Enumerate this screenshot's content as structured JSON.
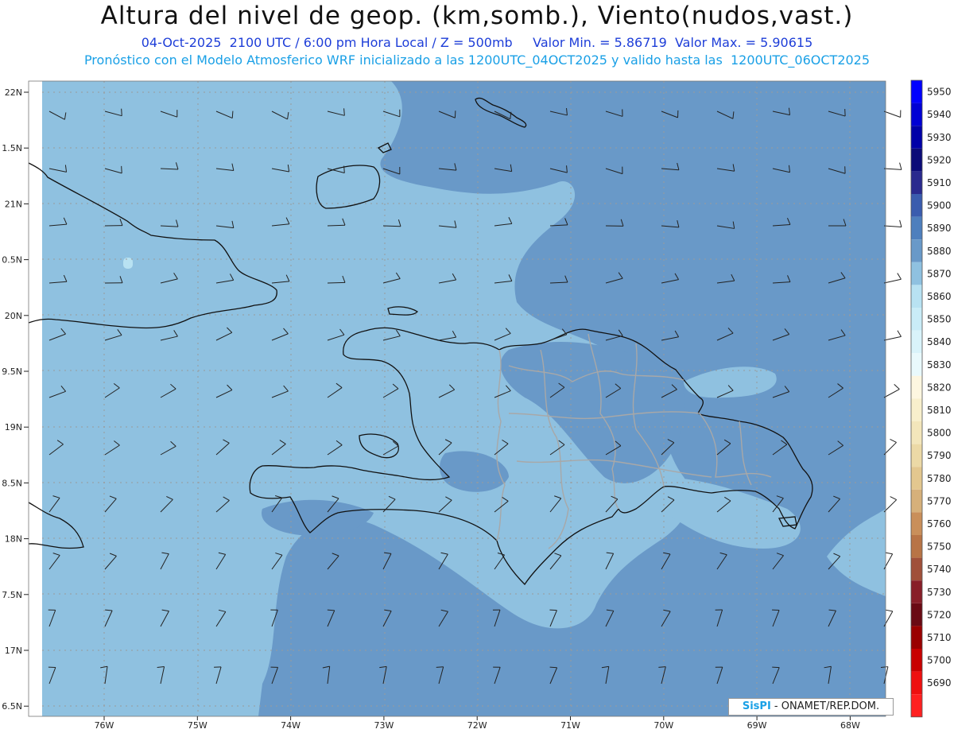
{
  "header": {
    "title": "Altura del nivel de geop. (km,somb.), Viento(nudos,vast.)",
    "line1": "04-Oct-2025  2100 UTC / 6:00 pm Hora Local / Z = 500mb     Valor Min. = 5.86719  Valor Max. = 5.90615",
    "line2": "Pronóstico con el Modelo Atmosferico WRF inicializado a las 1200UTC_04OCT2025 y valido hasta las  1200UTC_06OCT2025"
  },
  "axes": {
    "lat_labels": [
      "22N",
      "1.5N",
      "21N",
      "0.5N",
      "20N",
      "9.5N",
      "19N",
      "8.5N",
      "18N",
      "7.5N",
      "17N",
      "6.5N"
    ],
    "lon_labels": [
      "76W",
      "75W",
      "74W",
      "73W",
      "72W",
      "71W",
      "70W",
      "69W",
      "68W"
    ]
  },
  "colorbar": {
    "levels": [
      5950,
      5940,
      5930,
      5920,
      5910,
      5900,
      5890,
      5880,
      5870,
      5860,
      5850,
      5840,
      5830,
      5820,
      5810,
      5800,
      5790,
      5780,
      5770,
      5760,
      5750,
      5740,
      5730,
      5720,
      5710,
      5700,
      5690
    ],
    "colors": [
      "#0000ff",
      "#0000d4",
      "#0000a8",
      "#0c0c78",
      "#2a2a8e",
      "#3a5cae",
      "#4e7fbd",
      "#6999c8",
      "#8fc1e0",
      "#b8e2f2",
      "#c9ecf7",
      "#d9f3fa",
      "#e9f9fc",
      "#fdf6e0",
      "#f8efcc",
      "#f3e6bb",
      "#ecd9a6",
      "#e3c78f",
      "#d6b07a",
      "#c98f5a",
      "#b87446",
      "#a0503a",
      "#881e28",
      "#6a0a14",
      "#9a0000",
      "#c80000",
      "#ee1010",
      "#ff2020"
    ]
  },
  "map": {
    "colors": {
      "shade_5870": "#8fc1e0",
      "shade_5880": "#6999c8",
      "shade_5860": "#b8e2f2",
      "coast": "#111111",
      "province_border": "#a8a8a8",
      "barb": "#222222",
      "grid": "#9a9a9a"
    }
  },
  "credit": {
    "brand": "SisPI",
    "text": " - ONAMET/REP.DOM."
  }
}
